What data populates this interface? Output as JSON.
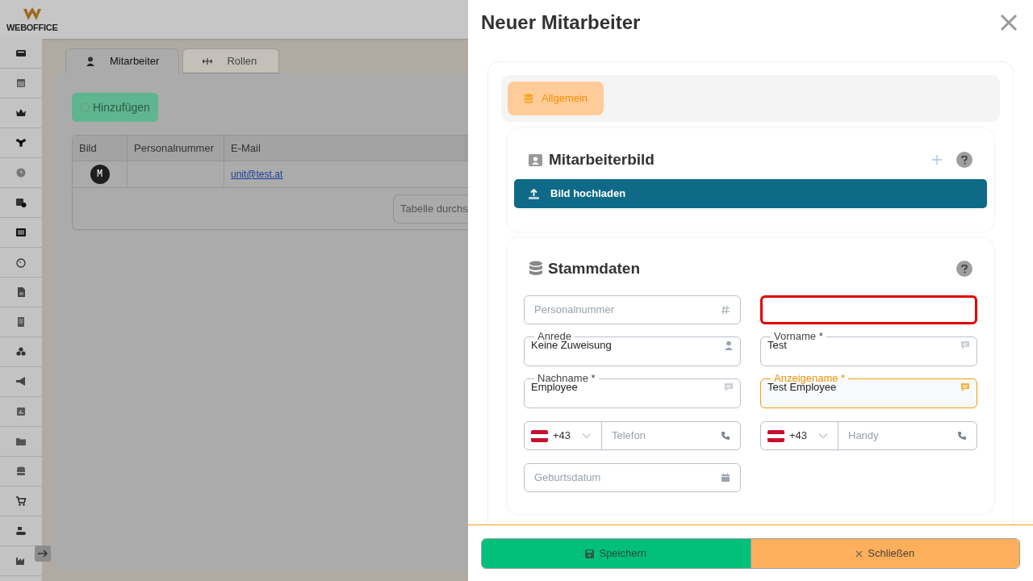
{
  "app": {
    "logo": "WEBOFFICE",
    "tabs": [
      {
        "label": "Mitarbeiter",
        "selected": true
      },
      {
        "label": "Rollen",
        "selected": false
      }
    ],
    "add_button": "Hinzufügen",
    "table": {
      "columns": [
        "Bild",
        "Personalnummer",
        "E-Mail"
      ],
      "rows": [
        {
          "avatar": "M",
          "email": "unit@test.at"
        }
      ]
    },
    "search": {
      "placeholder": "Tabelle durchs"
    }
  },
  "drawer": {
    "title": "Neuer Mitarbeiter",
    "tabs": [
      {
        "label": "Allgemein",
        "selected": true
      }
    ],
    "image_section": {
      "title": "Mitarbeiterbild",
      "upload_button": "Bild hochladen"
    },
    "data_section": {
      "title": "Stammdaten",
      "fields": [
        {
          "kind": "number",
          "placeholder": "Personalnummer",
          "focused": false,
          "highlighted": false
        },
        {
          "kind": "blank",
          "focused": false,
          "highlighted": true
        },
        {
          "kind": "select",
          "label": "Anrede",
          "value": "Keine Zuweisung",
          "focused": false,
          "highlighted": false
        },
        {
          "kind": "text",
          "label": "Vorname *",
          "value": "Test",
          "focused": false,
          "highlighted": false
        },
        {
          "kind": "text",
          "label": "Nachname *",
          "value": "Employee",
          "focused": false,
          "highlighted": false
        },
        {
          "kind": "text",
          "label": "Anzeigename *",
          "value": "Test Employee",
          "focused": true,
          "highlighted": false
        },
        {
          "kind": "phone",
          "code": "+43",
          "placeholder": "Telefon",
          "focused": false,
          "highlighted": false
        },
        {
          "kind": "phone",
          "code": "+43",
          "placeholder": "Handy",
          "focused": false,
          "highlighted": false
        },
        {
          "kind": "date",
          "placeholder": "Geburtsdatum",
          "focused": false,
          "highlighted": false
        }
      ]
    },
    "footer": {
      "save": "Speichern",
      "close": "Schließen"
    }
  }
}
